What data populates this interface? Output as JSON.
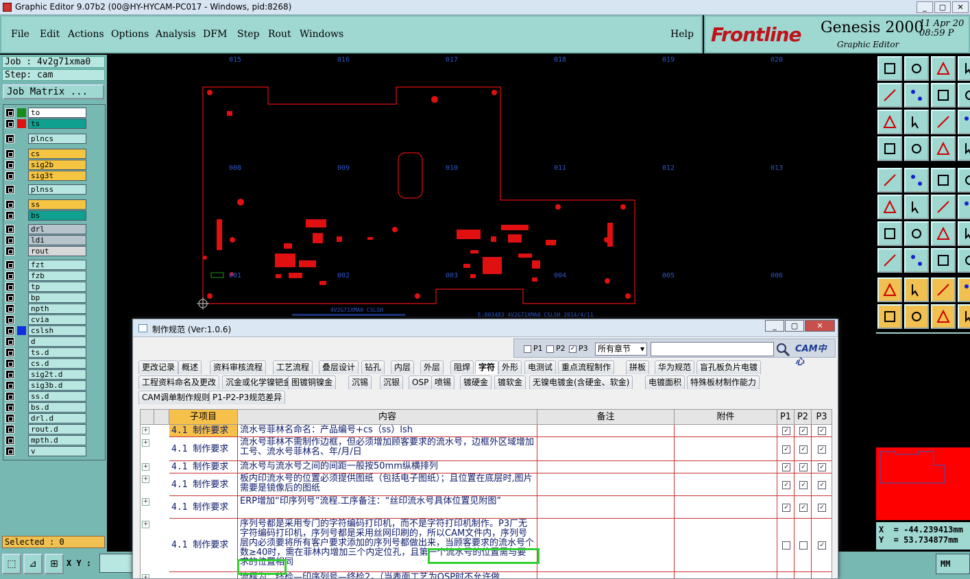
{
  "window": {
    "title": "Graphic Editor 9.07b2 (00@HY-HYCAM-PC017 - Windows, pid:8268)",
    "buttons": [
      "_",
      "▢",
      "✕"
    ]
  },
  "menu": {
    "items": [
      "File",
      "Edit",
      "Actions",
      "Options",
      "Analysis",
      "DFM",
      "Step",
      "Rout",
      "Windows"
    ],
    "help": "Help"
  },
  "brand": {
    "logo": "Frontline",
    "product": "Genesis 2000",
    "subtitle": "Graphic Editor",
    "date": "11 Apr 20",
    "time": "08:59 P"
  },
  "job": {
    "job_label": "Job : 4v2g71xma0",
    "step_label": "Step: cam",
    "matrix_button": "Job Matrix ..."
  },
  "layers": [
    {
      "name": "to",
      "swatch": "#1a8a1a",
      "bg": "#ffffff"
    },
    {
      "name": "ts",
      "swatch": "#e01010",
      "bg": "#10a090",
      "active": true
    },
    {
      "name": "plncs",
      "swatch": "",
      "bg": "#b8e6e0"
    },
    {
      "name": "cs",
      "swatch": "",
      "bg": "#f5c542"
    },
    {
      "name": "sig2b",
      "swatch": "",
      "bg": "#f5c542"
    },
    {
      "name": "sig3t",
      "swatch": "",
      "bg": "#f5c542"
    },
    {
      "name": "plnss",
      "swatch": "",
      "bg": "#b8e6e0"
    },
    {
      "name": "ss",
      "swatch": "",
      "bg": "#f5c542"
    },
    {
      "name": "bs",
      "swatch": "",
      "bg": "#10a090"
    },
    {
      "name": "drl",
      "swatch": "",
      "bg": "#b8c4cc"
    },
    {
      "name": "ldi",
      "swatch": "",
      "bg": "#b8c4cc"
    },
    {
      "name": "rout",
      "swatch": "",
      "bg": "#d8d8d8"
    },
    {
      "name": "fzt",
      "swatch": "",
      "bg": "#b8e6e0"
    },
    {
      "name": "fzb",
      "swatch": "",
      "bg": "#b8e6e0"
    },
    {
      "name": "tp",
      "swatch": "",
      "bg": "#b8e6e0"
    },
    {
      "name": "bp",
      "swatch": "",
      "bg": "#b8e6e0"
    },
    {
      "name": "npth",
      "swatch": "",
      "bg": "#b8e6e0"
    },
    {
      "name": "cvia",
      "swatch": "",
      "bg": "#b8e6e0"
    },
    {
      "name": "cslsh",
      "swatch": "#1030e0",
      "bg": "#b8e6e0"
    },
    {
      "name": "d",
      "swatch": "",
      "bg": "#b8e6e0"
    },
    {
      "name": "ts.d",
      "swatch": "",
      "bg": "#b8e6e0"
    },
    {
      "name": "cs.d",
      "swatch": "",
      "bg": "#b8e6e0"
    },
    {
      "name": "sig2t.d",
      "swatch": "",
      "bg": "#b8e6e0"
    },
    {
      "name": "sig3b.d",
      "swatch": "",
      "bg": "#b8e6e0"
    },
    {
      "name": "ss.d",
      "swatch": "",
      "bg": "#b8e6e0"
    },
    {
      "name": "bs.d",
      "swatch": "",
      "bg": "#b8e6e0"
    },
    {
      "name": "drl.d",
      "swatch": "",
      "bg": "#b8e6e0"
    },
    {
      "name": "rout.d",
      "swatch": "",
      "bg": "#b8e6e0"
    },
    {
      "name": "mpth.d",
      "swatch": "",
      "bg": "#b8e6e0"
    },
    {
      "name": "v",
      "swatch": "",
      "bg": "#b8e6e0"
    }
  ],
  "status": {
    "selected": "Selected : 0",
    "xy_label": "X Y :",
    "unit": "MM",
    "x_readout": "X  = -44.239413mm",
    "y_readout": "Y  = 53.734877mm"
  },
  "canvas": {
    "grid_labels_top": [
      "015",
      "016",
      "017",
      "018",
      "019",
      "020"
    ],
    "grid_labels_mid": [
      "008",
      "009",
      "010",
      "011",
      "012",
      "013"
    ],
    "grid_labels_bot": [
      "001",
      "002",
      "003",
      "004",
      "005",
      "006"
    ],
    "board_text_left": "4V2G71XMA0 CSLSH",
    "board_text_right": "E:803483 4V2G71XMA0 CSLSH 2014/4/11"
  },
  "dialog": {
    "title": "制作规范 (Ver:1.0.6)",
    "p_labels": [
      "P1",
      "P2",
      "P3"
    ],
    "p_checked": [
      false,
      false,
      true
    ],
    "chapter_select": "所有章节",
    "cam_logo": "CAM中心",
    "tabs_row1": [
      "更改记录",
      "概述",
      "资料审核流程",
      "工艺流程",
      "叠层设计",
      "钻孔",
      "内层",
      "外层",
      "阻焊",
      "字符",
      "外形",
      "电测试",
      "重点流程制作",
      "拼板",
      "华为规范",
      "盲孔板负片电镀"
    ],
    "tabs_row2": [
      "工程资料命名及更改",
      "沉金或化学镍钯金",
      "图镀铜镍金",
      "沉锡",
      "沉银",
      "OSP",
      "喷锡",
      "镀硬金",
      "镀软金",
      "无镍电镀金(含硬金、软金)",
      "电镀面积",
      "特殊板材制作能力"
    ],
    "tabs_row3": [
      "CAM调单制作规则",
      "P1-P2-P3规范差异"
    ],
    "active_tab": "字符",
    "columns": [
      "子项目",
      "内容",
      "备注",
      "附件",
      "P1",
      "P2",
      "P3"
    ],
    "rows": [
      {
        "sub": "4.1 制作要求",
        "content": "流水号菲林名命名：产品编号+cs（ss）lsh",
        "p": [
          true,
          true,
          true
        ]
      },
      {
        "sub": "4.1 制作要求",
        "content": "流水号菲林不需制作边框，但必须增加顾客要求的流水号，边框外区域增加工号、流水号菲林名、年/月/日",
        "p": [
          true,
          true,
          true
        ]
      },
      {
        "sub": "4.1 制作要求",
        "content": "流水号与流水号之间的间距一般按50mm纵横排列",
        "p": [
          true,
          true,
          true
        ]
      },
      {
        "sub": "4.1 制作要求",
        "content": "板内印流水号的位置必须提供图纸（包括电子图纸）；且位置在底层时,图片需要是镜像后的图纸",
        "p": [
          true,
          true,
          true
        ]
      },
      {
        "sub": "4.1 制作要求",
        "content": "ERP增加“印序列号”流程.工序备注：“丝印流水号具体位置见附图”",
        "p": [
          true,
          true,
          true
        ]
      },
      {
        "sub": "4.1 制作要求",
        "content": "序列号都是采用专门的字符编码打印机，而不是字符打印机制作。P3厂无字符编码打印机，序列号都是采用丝网印刷的，所以CAM文件内，序列号层内必须要将所有客户要求添加的序列号都做出来，当顾客要求的流水号个数≥40时，需在菲林内增加三个内定位孔，且第一个流水号的位置需与要求的位置相同",
        "p": [
          false,
          false,
          true
        ]
      },
      {
        "sub": "",
        "content": "流程为：终检—印序列号—终检2，（当表面工艺为OSP时不允许做",
        "p": [
          false,
          false,
          false
        ]
      }
    ]
  }
}
